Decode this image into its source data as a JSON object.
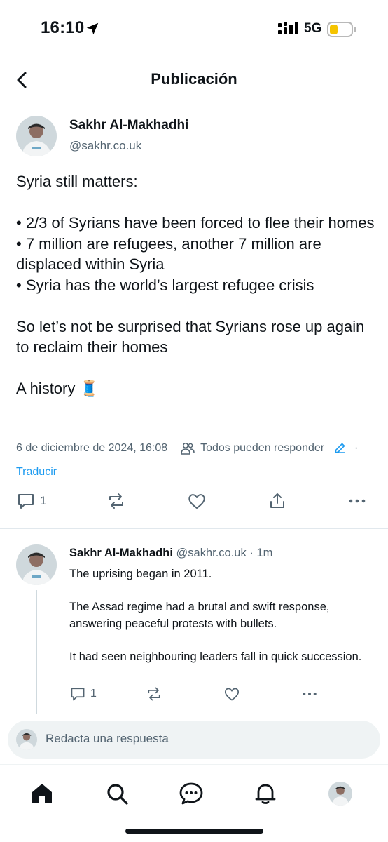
{
  "status_bar": {
    "time": "16:10",
    "network": "5G",
    "battery_color": "#f5c400"
  },
  "header": {
    "title": "Publicación"
  },
  "post": {
    "author_name": "Sakhr Al-Makhadhi",
    "author_handle": "@sakhr.co.uk",
    "text": "Syria still matters:\n\n• 2/3 of Syrians have been forced to flee their homes\n• 7 million are refugees, another 7 million are displaced within Syria\n• Syria has the world’s largest refugee crisis\n\nSo let’s not be surprised that Syrians rose up again to reclaim their homes\n\nA history 🧵",
    "timestamp": "6 de diciembre de 2024, 16:08",
    "reply_setting": "Todos pueden responder",
    "separator": "·",
    "translate_label": "Traducir",
    "reply_count": "1"
  },
  "reply": {
    "author_name": "Sakhr Al-Makhadhi",
    "author_handle": "@sakhr.co.uk",
    "separator": "·",
    "time": "1m",
    "text": "The uprising began in 2011.\n\nThe Assad regime had a brutal and swift response, answering peaceful protests with bullets.\n\nIt had seen neighbouring leaders fall in quick succession.",
    "reply_count": "1"
  },
  "compose": {
    "placeholder": "Redacta una respuesta"
  },
  "icons": {
    "back": "chevron-left-icon",
    "reply": "comment-icon",
    "repost": "repost-icon",
    "like": "heart-icon",
    "share": "share-icon",
    "more": "more-icon",
    "home": "home-icon",
    "search": "search-icon",
    "messages": "chat-icon",
    "notifications": "bell-icon"
  },
  "colors": {
    "accent": "#1d9bf0",
    "text": "#0f1419",
    "muted": "#536471"
  }
}
